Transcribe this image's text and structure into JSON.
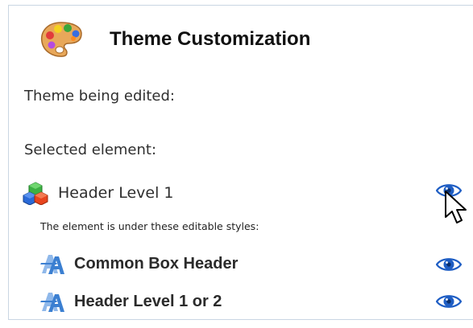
{
  "panel": {
    "title": "Theme Customization",
    "title_icon": "palette-icon"
  },
  "theme_label": "Theme being edited:",
  "selected_label": "Selected element:",
  "selected_element": {
    "name": "Header Level 1",
    "icon": "cubes-icon",
    "visibility_icon": "eye-icon"
  },
  "styles_note": "The element is under these editable styles:",
  "styles": [
    {
      "name": "Common Box Header",
      "icon": "style-font-icon",
      "visibility_icon": "eye-icon"
    },
    {
      "name": "Header Level 1 or 2",
      "icon": "style-font-icon",
      "visibility_icon": "eye-icon"
    }
  ],
  "colors": {
    "panel_border": "#c9d6e3",
    "eye_blue": "#1f5ec4",
    "style_icon_blue": "#3b7fd1"
  }
}
